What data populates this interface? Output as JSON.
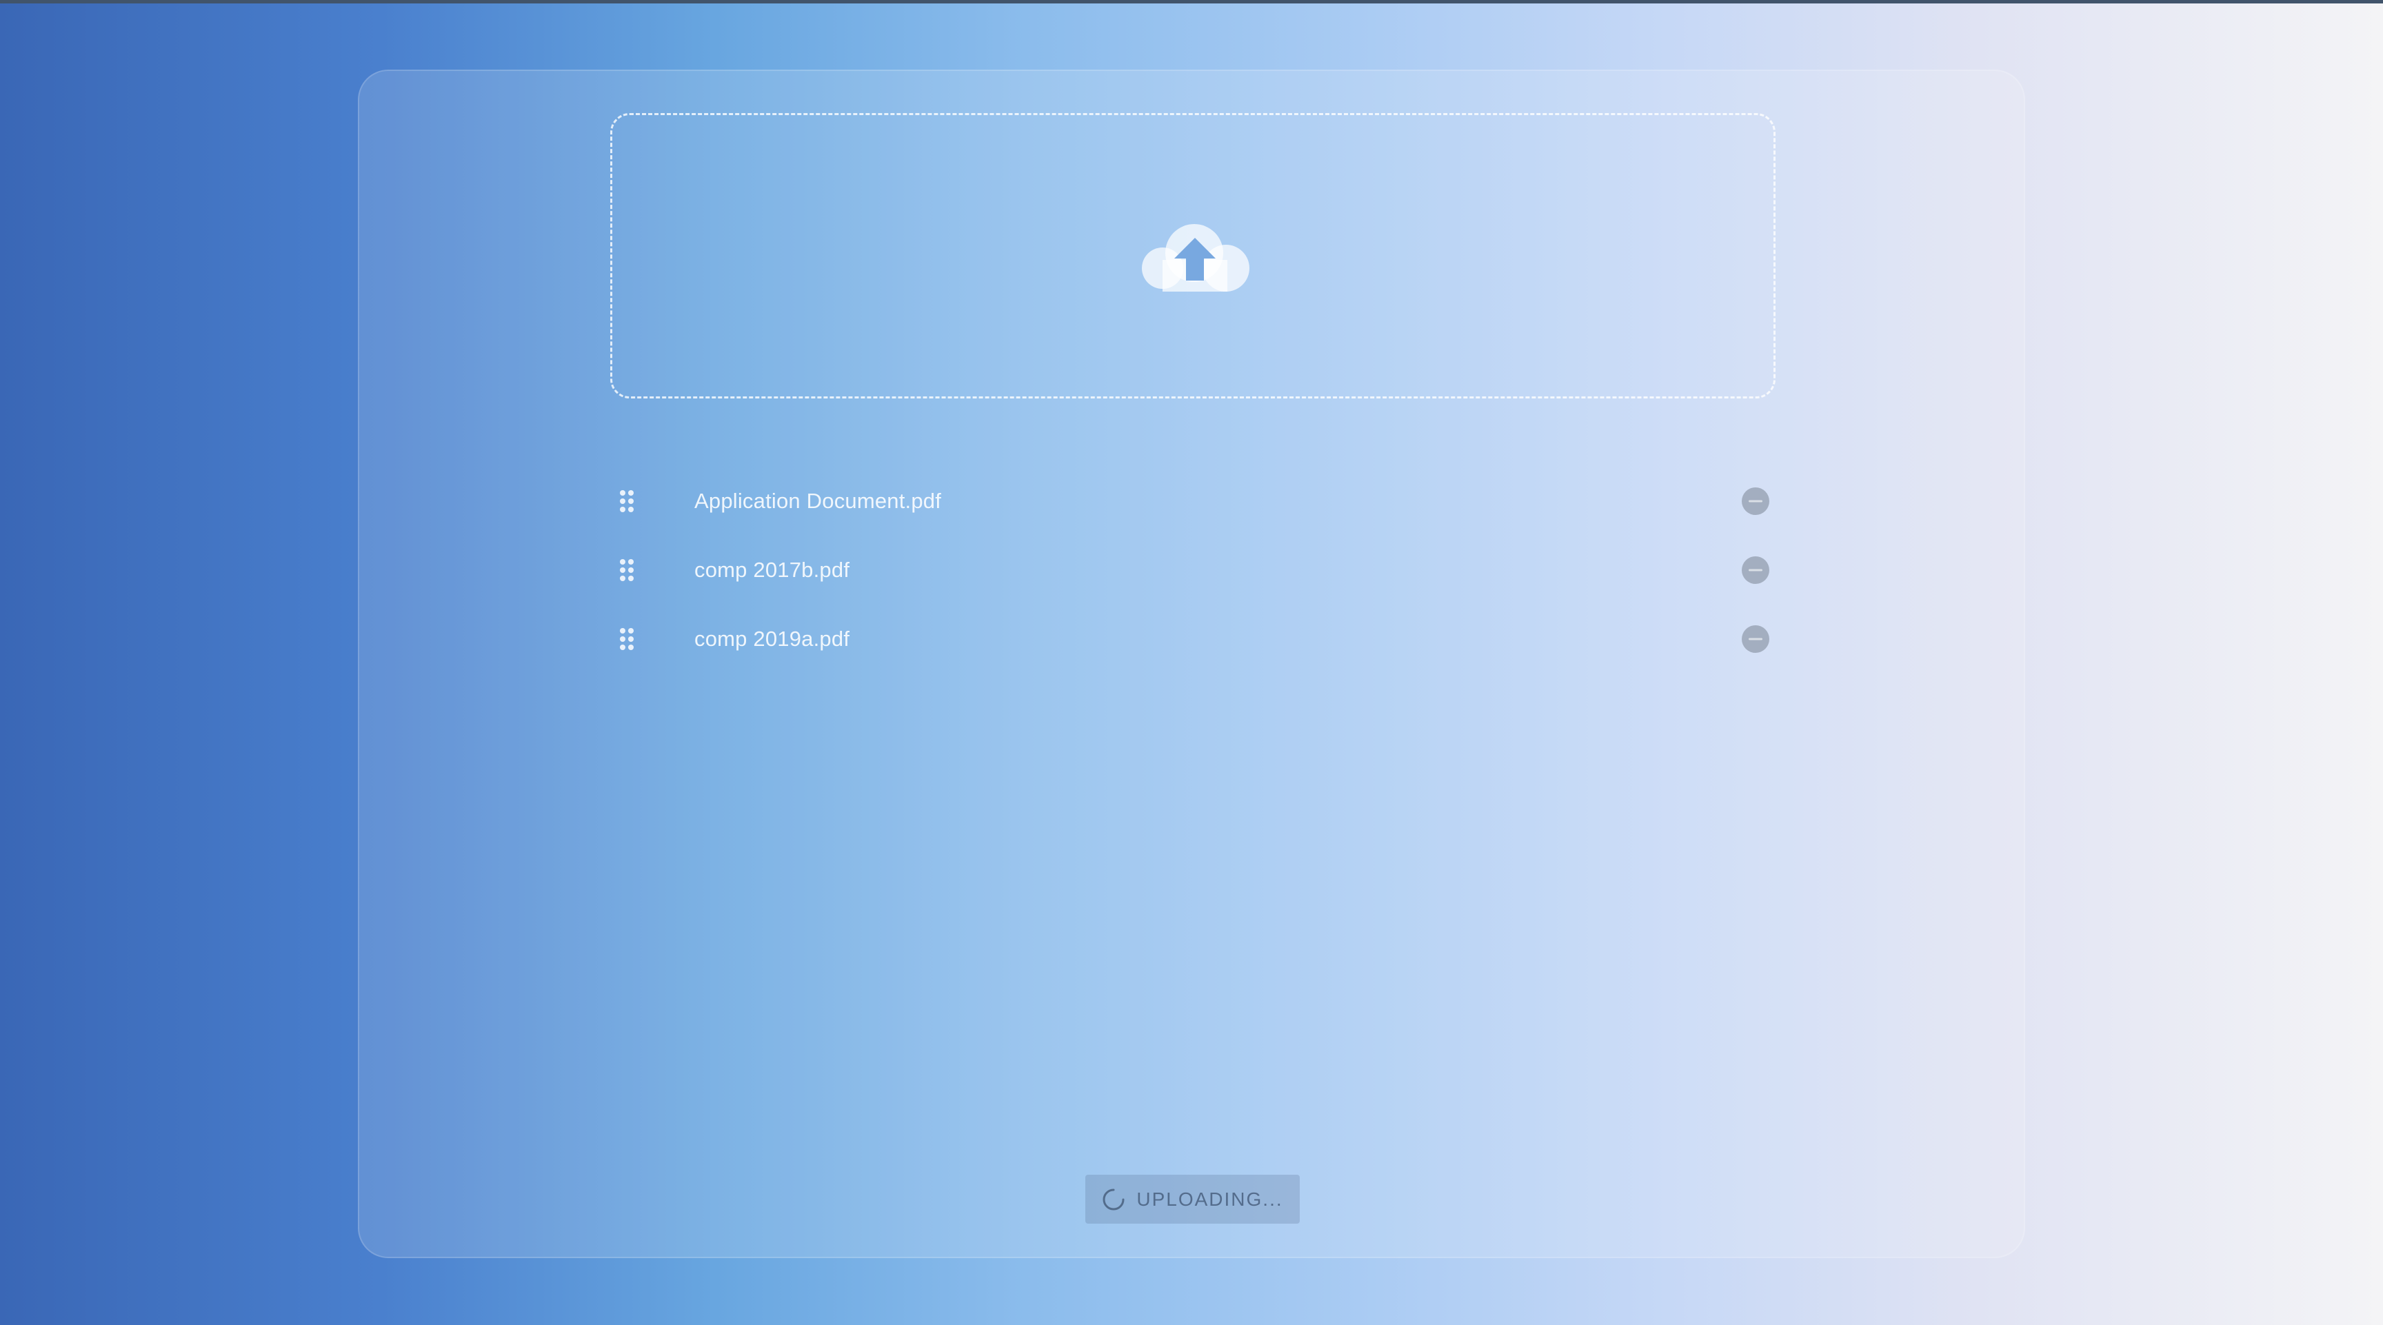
{
  "uploader": {
    "dropzone_icon": "cloud-upload-icon",
    "files": [
      {
        "name": "Application Document.pdf"
      },
      {
        "name": "comp 2017b.pdf"
      },
      {
        "name": "comp 2019a.pdf"
      }
    ],
    "drag_icon": "drag-handle-icon",
    "remove_icon": "remove-circle-icon",
    "upload_button": {
      "label": "UPLOADING...",
      "icon": "spinner-icon",
      "state": "disabled"
    }
  },
  "colors": {
    "gradient_start": "#3a67b6",
    "gradient_end": "#f4f4f6",
    "remove_button": "#9aa4b6"
  }
}
